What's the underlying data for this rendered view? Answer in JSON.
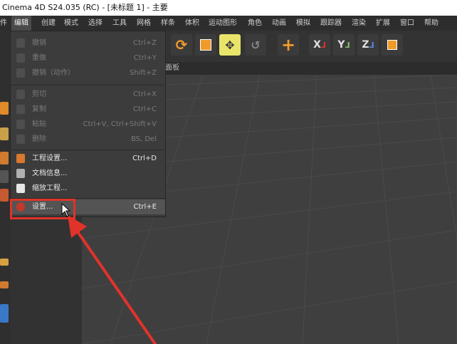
{
  "window": {
    "title": "Cinema 4D S24.035 (RC) - [未标题 1] - 主要"
  },
  "menubar": {
    "items": [
      "件",
      "编辑",
      "创建",
      "模式",
      "选择",
      "工具",
      "网格",
      "样条",
      "体积",
      "运动图形",
      "角色",
      "动画",
      "模拟",
      "跟踪器",
      "渲染",
      "扩展",
      "窗口",
      "帮助"
    ],
    "active_index": 1
  },
  "edit_menu": {
    "group1": [
      {
        "label": "撤销",
        "shortcut": "Ctrl+Z"
      },
      {
        "label": "重做",
        "shortcut": "Ctrl+Y"
      },
      {
        "label": "撤销（动作）",
        "shortcut": "Shift+Z"
      }
    ],
    "group2": [
      {
        "label": "剪切",
        "shortcut": "Ctrl+X"
      },
      {
        "label": "复制",
        "shortcut": "Ctrl+C"
      },
      {
        "label": "粘贴",
        "shortcut": "Ctrl+V, Ctrl+Shift+V"
      },
      {
        "label": "删除",
        "shortcut": "BS, Del"
      }
    ],
    "group3": [
      {
        "label": "工程设置...",
        "shortcut": "Ctrl+D"
      },
      {
        "label": "文档信息...",
        "shortcut": ""
      },
      {
        "label": "缩放工程...",
        "shortcut": ""
      }
    ],
    "group4": [
      {
        "label": "设置...",
        "shortcut": "Ctrl+E"
      }
    ]
  },
  "toolbar": {
    "axis_labels": {
      "x": "X",
      "y": "Y",
      "z": "Z"
    }
  },
  "viewport": {
    "tab_label": "面板"
  },
  "colors": {
    "annotation_red": "#e0332a",
    "accent_orange": "#f09a2a",
    "selected_yellow": "#e9e46a"
  }
}
